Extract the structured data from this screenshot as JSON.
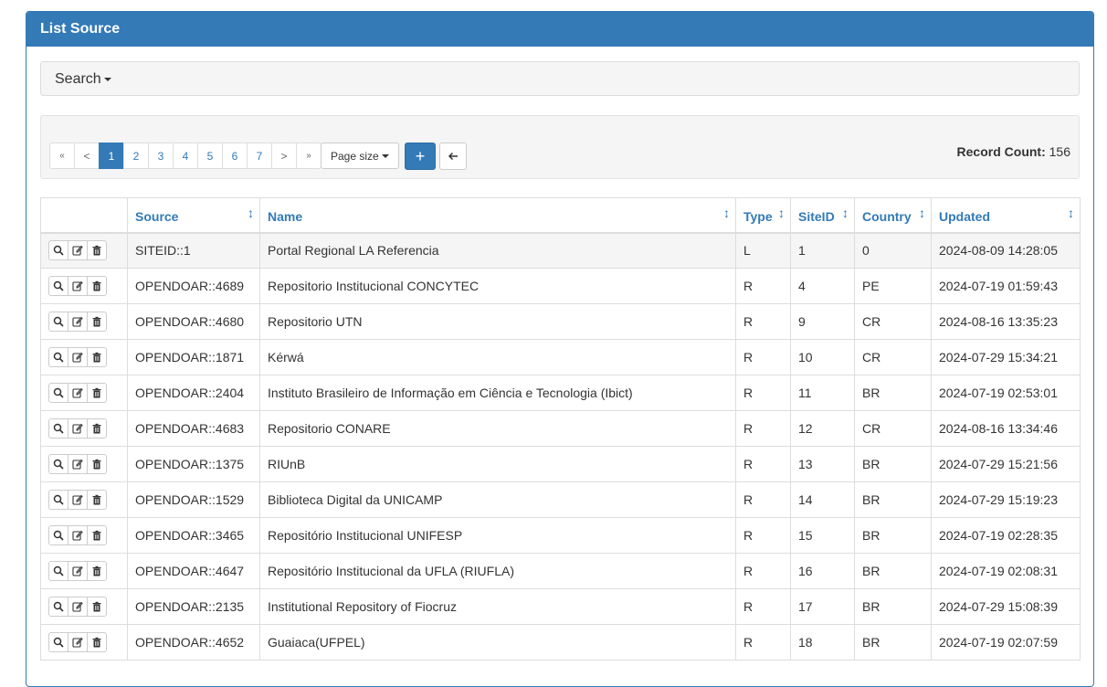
{
  "panel": {
    "title": "List Source"
  },
  "search": {
    "label": "Search"
  },
  "pager": {
    "first": "«",
    "prev": "<",
    "pages": [
      "1",
      "2",
      "3",
      "4",
      "5",
      "6",
      "7"
    ],
    "next": ">",
    "last": "»",
    "active_page": "1",
    "page_size_label": "Page size"
  },
  "toolbar": {
    "add_label": "+",
    "back_label": "←"
  },
  "record_count": {
    "label": "Record Count:",
    "value": "156"
  },
  "table": {
    "headers": {
      "source": "Source",
      "name": "Name",
      "type": "Type",
      "siteid": "SiteID",
      "country": "Country",
      "updated": "Updated"
    },
    "rows": [
      {
        "source": "SITEID::1",
        "name": "Portal Regional LA Referencia",
        "type": "L",
        "siteid": "1",
        "country": "0",
        "updated": "2024-08-09 14:28:05"
      },
      {
        "source": "OPENDOAR::4689",
        "name": "Repositorio Institucional CONCYTEC",
        "type": "R",
        "siteid": "4",
        "country": "PE",
        "updated": "2024-07-19 01:59:43"
      },
      {
        "source": "OPENDOAR::4680",
        "name": "Repositorio UTN",
        "type": "R",
        "siteid": "9",
        "country": "CR",
        "updated": "2024-08-16 13:35:23"
      },
      {
        "source": "OPENDOAR::1871",
        "name": "Kérwá",
        "type": "R",
        "siteid": "10",
        "country": "CR",
        "updated": "2024-07-29 15:34:21"
      },
      {
        "source": "OPENDOAR::2404",
        "name": "Instituto Brasileiro de Informação em Ciência e Tecnologia (Ibict)",
        "type": "R",
        "siteid": "11",
        "country": "BR",
        "updated": "2024-07-19 02:53:01"
      },
      {
        "source": "OPENDOAR::4683",
        "name": "Repositorio CONARE",
        "type": "R",
        "siteid": "12",
        "country": "CR",
        "updated": "2024-08-16 13:34:46"
      },
      {
        "source": "OPENDOAR::1375",
        "name": "RIUnB",
        "type": "R",
        "siteid": "13",
        "country": "BR",
        "updated": "2024-07-29 15:21:56"
      },
      {
        "source": "OPENDOAR::1529",
        "name": "Biblioteca Digital da UNICAMP",
        "type": "R",
        "siteid": "14",
        "country": "BR",
        "updated": "2024-07-29 15:19:23"
      },
      {
        "source": "OPENDOAR::3465",
        "name": "Repositório Institucional UNIFESP",
        "type": "R",
        "siteid": "15",
        "country": "BR",
        "updated": "2024-07-19 02:28:35"
      },
      {
        "source": "OPENDOAR::4647",
        "name": "Repositório Institucional da UFLA (RIUFLA)",
        "type": "R",
        "siteid": "16",
        "country": "BR",
        "updated": "2024-07-19 02:08:31"
      },
      {
        "source": "OPENDOAR::2135",
        "name": "Institutional Repository of Fiocruz",
        "type": "R",
        "siteid": "17",
        "country": "BR",
        "updated": "2024-07-29 15:08:39"
      },
      {
        "source": "OPENDOAR::4652",
        "name": "Guaiaca(UFPEL)",
        "type": "R",
        "siteid": "18",
        "country": "BR",
        "updated": "2024-07-19 02:07:59"
      }
    ]
  },
  "colors": {
    "primary": "#337ab7",
    "border": "#dddddd",
    "well": "#f5f5f5"
  }
}
